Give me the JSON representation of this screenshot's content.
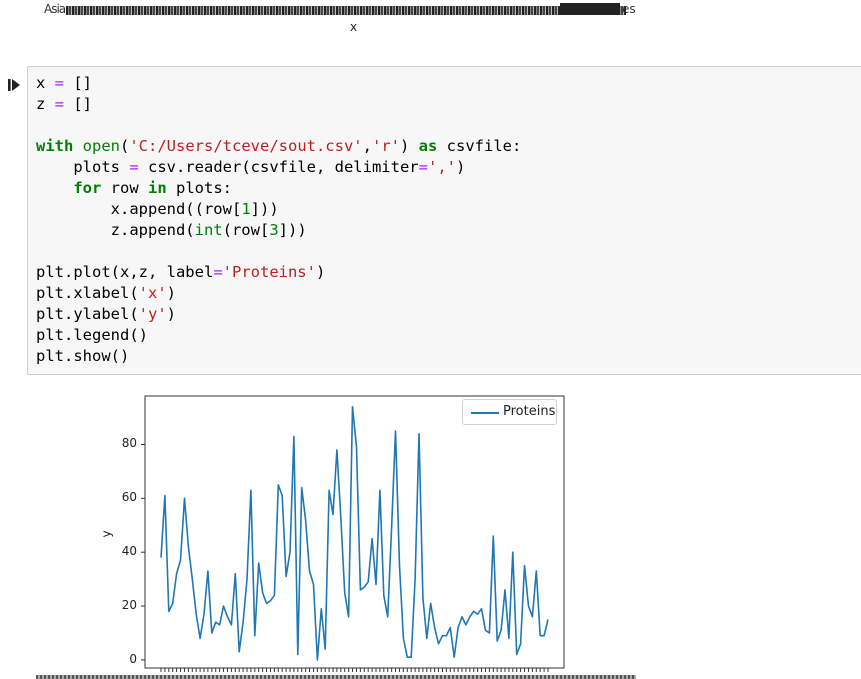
{
  "prev_output": {
    "legend_text": "Asia",
    "xlabel": "x",
    "legend_tail": "es"
  },
  "cell": {
    "code_lines": [
      "x = []",
      "z = []",
      "",
      "with open('C:/Users/tceve/sout.csv','r') as csvfile:",
      "    plots = csv.reader(csvfile, delimiter=',')",
      "    for row in plots:",
      "        x.append((row[1]))",
      "        z.append(int(row[3]))",
      "",
      "plt.plot(x,z, label='Proteins')",
      "plt.xlabel('x')",
      "plt.ylabel('y')",
      "plt.legend()",
      "plt.show()"
    ]
  },
  "colors": {
    "line": "#1f77b4",
    "cell_bg": "#f7f7f7",
    "keyword": "#008000",
    "string": "#ba2121",
    "operator": "#aa22ff"
  },
  "chart_data": {
    "type": "line",
    "ylabel": "y",
    "xlabel": "",
    "ylim": [
      -3,
      98
    ],
    "yticks": [
      "0",
      "20",
      "40",
      "60",
      "80"
    ],
    "series": [
      {
        "name": "Proteins",
        "values": [
          38,
          61,
          18,
          21,
          32,
          37,
          60,
          42,
          30,
          17,
          8,
          17,
          33,
          10,
          14,
          13,
          20,
          16,
          13,
          32,
          3,
          14,
          30,
          63,
          9,
          36,
          25,
          21,
          22,
          24,
          65,
          61,
          31,
          40,
          83,
          2,
          64,
          52,
          33,
          28,
          0,
          19,
          4,
          63,
          54,
          78,
          53,
          25,
          16,
          94,
          79,
          26,
          27,
          29,
          45,
          28,
          63,
          24,
          16,
          49,
          85,
          35,
          8,
          1,
          1,
          30,
          84,
          23,
          8,
          21,
          12,
          6,
          9,
          9,
          12,
          1,
          12,
          16,
          13,
          16,
          18,
          17,
          19,
          11,
          10,
          46,
          7,
          11,
          26,
          8,
          40,
          2,
          6,
          35,
          20,
          16,
          33,
          9,
          9,
          15
        ]
      }
    ],
    "legend": "top-right",
    "grid": false
  }
}
